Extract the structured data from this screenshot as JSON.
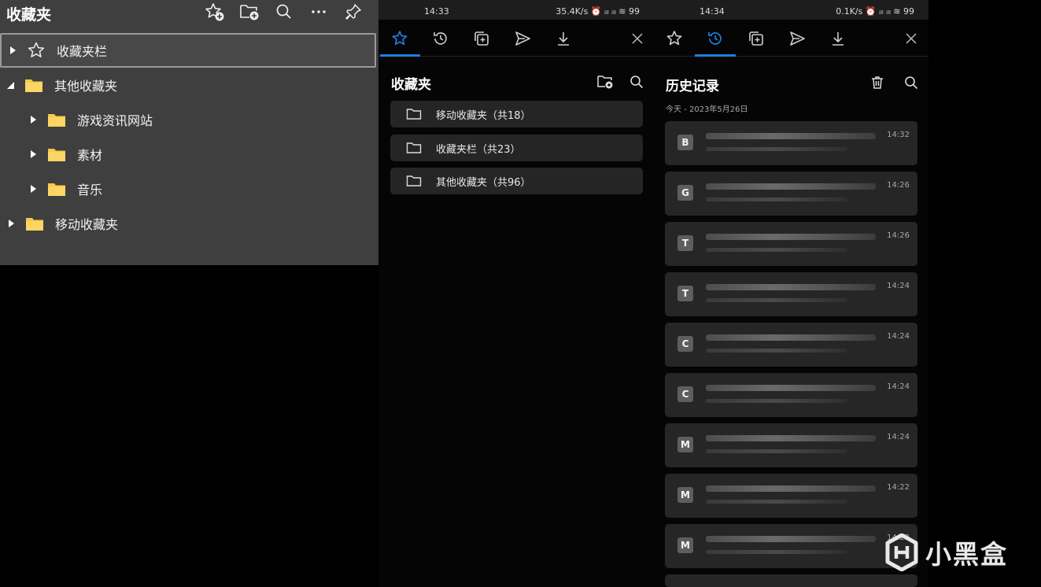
{
  "desktop": {
    "title": "收藏夹",
    "tree": [
      {
        "label": "收藏夹栏",
        "icon": "star-icon",
        "level": 0,
        "expanded": false,
        "selected": true
      },
      {
        "label": "其他收藏夹",
        "icon": "folder-icon",
        "level": 0,
        "expanded": true,
        "selected": false
      },
      {
        "label": "游戏资讯网站",
        "icon": "folder-icon",
        "level": 1,
        "expanded": false,
        "selected": false
      },
      {
        "label": "素材",
        "icon": "folder-icon",
        "level": 1,
        "expanded": false,
        "selected": false
      },
      {
        "label": "音乐",
        "icon": "folder-icon",
        "level": 1,
        "expanded": false,
        "selected": false
      },
      {
        "label": "移动收藏夹",
        "icon": "folder-icon",
        "level": 0,
        "expanded": false,
        "selected": false
      }
    ]
  },
  "mobile1": {
    "status_time": "14:33",
    "status_net": "35.4K/s ⏰ ᵢₗₗ ᵢₗₗ ≋ 99",
    "section_title": "收藏夹",
    "folders": [
      {
        "label": "移动收藏夹（共18）"
      },
      {
        "label": "收藏夹栏（共23）"
      },
      {
        "label": "其他收藏夹（共96）"
      }
    ]
  },
  "mobile2": {
    "status_time": "14:34",
    "status_net": "0.1K/s ⏰ ᵢₗₗ ᵢₗₗ ≋ 99",
    "section_title": "历史记录",
    "date_label": "今天 - 2023年5月26日",
    "history": [
      {
        "letter": "B",
        "time": "14:32"
      },
      {
        "letter": "G",
        "time": "14:26"
      },
      {
        "letter": "T",
        "time": "14:26"
      },
      {
        "letter": "T",
        "time": "14:24"
      },
      {
        "letter": "C",
        "time": "14:24"
      },
      {
        "letter": "C",
        "time": "14:24"
      },
      {
        "letter": "M",
        "time": "14:24"
      },
      {
        "letter": "M",
        "time": "14:22"
      },
      {
        "letter": "M",
        "time": "14:22"
      }
    ]
  },
  "watermark": {
    "text": "小黑盒"
  },
  "colors": {
    "accent": "#1e7fe0",
    "folder": "#f7c948",
    "panel": "#3f3f3f"
  }
}
